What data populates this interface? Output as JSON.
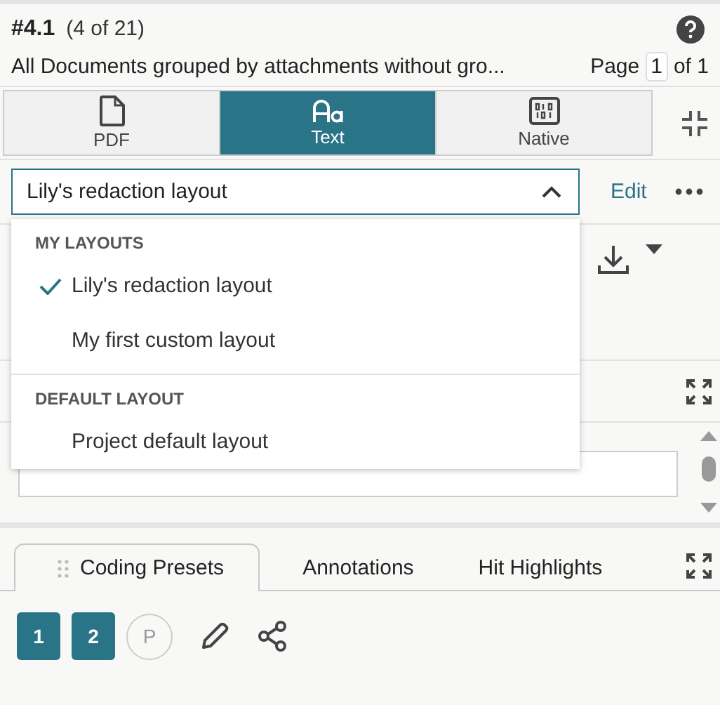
{
  "header": {
    "doc_id": "#4.1",
    "position": "(4 of 21)",
    "search_name": "All Documents grouped by attachments without gro...",
    "page_label": "Page",
    "page": "1",
    "page_of": "of 1"
  },
  "viewer_tabs": [
    {
      "label": "PDF",
      "kind": "pdf",
      "selected": false
    },
    {
      "label": "Text",
      "kind": "text",
      "selected": true
    },
    {
      "label": "Native",
      "kind": "native",
      "selected": false
    }
  ],
  "layout_select": {
    "value": "Lily's redaction layout",
    "expanded": true
  },
  "edit_link": "Edit",
  "layout_menu": [
    {
      "heading": "MY LAYOUTS",
      "items": [
        {
          "label": "Lily's redaction layout",
          "selected": true
        },
        {
          "label": "My first custom layout",
          "selected": false
        }
      ]
    },
    {
      "heading": "DEFAULT LAYOUT",
      "items": [
        {
          "label": "Project default layout",
          "selected": false
        }
      ]
    }
  ],
  "bottom_tabs": [
    {
      "label": "Coding Presets",
      "selected": true
    },
    {
      "label": "Annotations",
      "selected": false
    },
    {
      "label": "Hit Highlights",
      "selected": false
    }
  ],
  "presets": [
    {
      "label": "1",
      "kind": "number"
    },
    {
      "label": "2",
      "kind": "number"
    },
    {
      "label": "P",
      "kind": "circle"
    }
  ]
}
